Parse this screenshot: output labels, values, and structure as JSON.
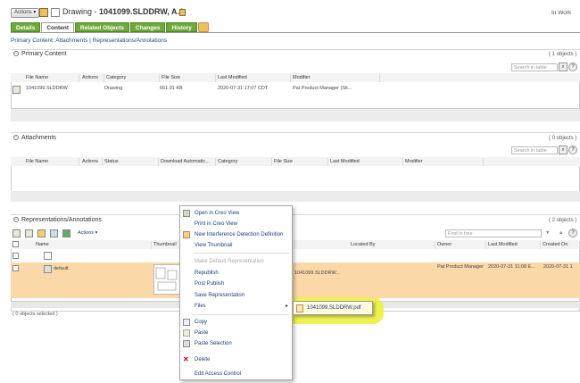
{
  "header": {
    "actions_label": "Actions",
    "title_prefix": "Drawing - ",
    "title_bold": "1041099.SLDDRW, A.1",
    "status": "In Work"
  },
  "tabs": [
    {
      "label": "Details"
    },
    {
      "label": "Content"
    },
    {
      "label": "Related Objects"
    },
    {
      "label": "Changes"
    },
    {
      "label": "History"
    }
  ],
  "breadcrumb": "Primary Content: Attachments | Representations/Annotations",
  "primary": {
    "title": "Primary Content",
    "count": "( 1 objects )",
    "search_placeholder": "Search in table",
    "columns": [
      "File Name",
      "Actions",
      "Category",
      "File Size",
      "Last Modified",
      "Modifier"
    ],
    "row": {
      "file": "1041099.SLDDRW",
      "category": "Drawing",
      "size": "651.91 KB",
      "modified": "2020-07-31 17:07 CDT",
      "modifier": "Pat Product Manager (Sit..."
    }
  },
  "attachments": {
    "title": "Attachments",
    "count": "( 0 objects )",
    "search_placeholder": "Search in table",
    "columns": [
      "File Name",
      "Actions",
      "Status",
      "Download Automatic...",
      "Category",
      "File Size",
      "Last Modified",
      "Modifier"
    ]
  },
  "representations": {
    "title": "Representations/Annotations",
    "count": "( 2 objects )",
    "actions_label": "Actions",
    "find_placeholder": "Find in tree",
    "columns": [
      "Name",
      "Thumbnail",
      "Located By",
      "Owner",
      "Last Modified",
      "Created On"
    ],
    "row": {
      "name": "default",
      "located": "1041099.SLDDRW...",
      "owner": "Pat Product Manager",
      "modified": "2020-07-31 11:08 E...",
      "created": "2020-07-31 1"
    },
    "selected_text": "( 0 objects selected )"
  },
  "context_menu": {
    "items": [
      {
        "label": "Open in Creo View",
        "disabled": false
      },
      {
        "label": "Print in Creo View",
        "disabled": false
      },
      {
        "label": "New Interference Detection Definition",
        "disabled": false
      },
      {
        "label": "View Thumbnail",
        "disabled": false
      },
      {
        "label": "Make Default Representation",
        "disabled": true
      },
      {
        "label": "Republish",
        "disabled": false
      },
      {
        "label": "Post Publish",
        "disabled": false
      },
      {
        "label": "Save Representation",
        "disabled": false
      },
      {
        "label": "Files",
        "disabled": false
      },
      {
        "label": "Copy",
        "disabled": false
      },
      {
        "label": "Paste",
        "disabled": false
      },
      {
        "label": "Paste Selection",
        "disabled": false
      },
      {
        "label": "Delete",
        "disabled": false
      },
      {
        "label": "Edit Access Control",
        "disabled": false
      }
    ],
    "submenu_file": "1041099.SLDDRW.pdf"
  },
  "colors": {
    "tab_green": "#6fa93a",
    "highlight": "#ebf032",
    "selected_row": "#fad8a8",
    "link": "#1d4a8a"
  }
}
